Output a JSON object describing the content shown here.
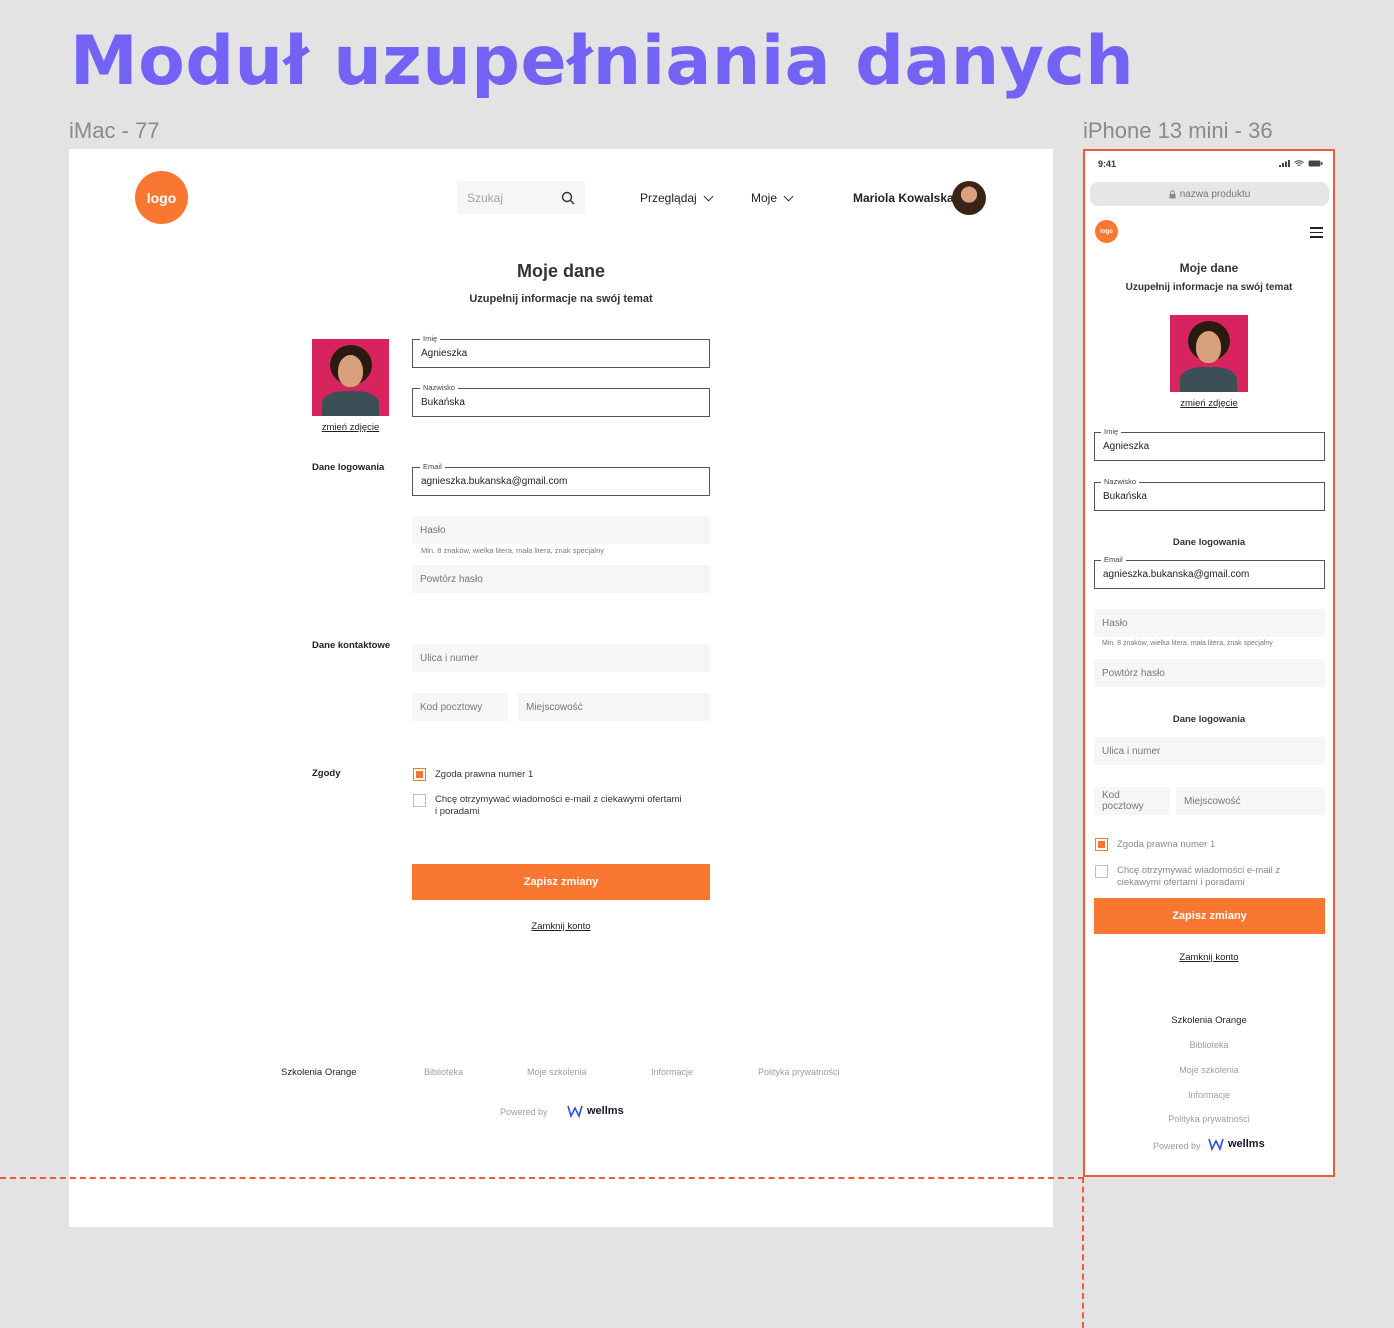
{
  "page_title": "Moduł uzupełniania danych",
  "frames": {
    "desktop_label": "iMac - 77",
    "mobile_label": "iPhone 13 mini - 36"
  },
  "colors": {
    "accent": "#f97731",
    "title": "#7363f5",
    "frame_outline": "#ee5a3e"
  },
  "header": {
    "logo": "logo",
    "search_placeholder": "Szukaj",
    "nav": [
      "Przeglądaj",
      "Moje"
    ],
    "user_name": "Mariola Kowalska"
  },
  "form": {
    "title": "Moje dane",
    "subtitle": "Uzupełnij informacje na swój temat",
    "change_photo": "zmień zdjęcie",
    "first_name": {
      "label": "Imię",
      "value": "Agnieszka"
    },
    "last_name": {
      "label": "Nazwisko",
      "value": "Bukańska"
    },
    "login_section": "Dane logowania",
    "email": {
      "label": "Email",
      "value": "agnieszka.bukanska@gmail.com"
    },
    "password_placeholder": "Hasło",
    "password_hint": "Min. 8 znaków, wielka litera, mała litera, znak specjalny",
    "repeat_password_placeholder": "Powtórz hasło",
    "contact_section": "Dane kontaktowe",
    "street_placeholder": "Ulica i numer",
    "zip_placeholder": "Kod pocztowy",
    "city_placeholder": "Miejscowość",
    "consents_section": "Zgody",
    "consent1": {
      "label": "Zgoda prawna numer 1",
      "checked": true
    },
    "consent2": {
      "label": "Chcę otrzymywać wiadomości e-mail z ciekawymi ofertami i poradami",
      "checked": false
    },
    "save_button": "Zapisz zmiany",
    "close_account": "Zamknij konto"
  },
  "footer": {
    "brand": "Szkolenia Orange",
    "links": [
      "Biblioteka",
      "Moje szkolenia",
      "Informacje",
      "Polityka prywatności"
    ],
    "powered_by": "Powered by",
    "wellms": "wellms"
  },
  "mobile": {
    "time": "9:41",
    "url": "nazwa produktu",
    "logo": "logo",
    "contact_section": "Dane logowania"
  }
}
